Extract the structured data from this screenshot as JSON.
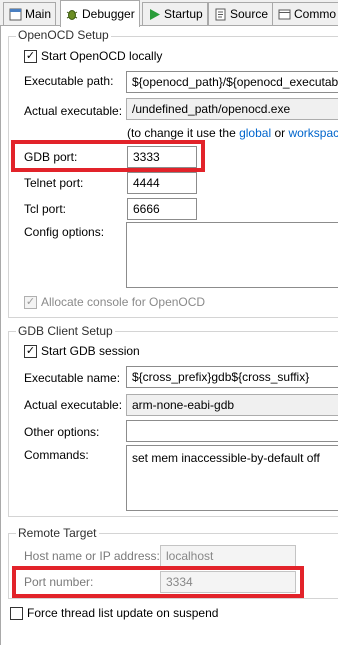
{
  "tabs": [
    {
      "label": "Main",
      "icon": "main-tab-icon"
    },
    {
      "label": "Debugger",
      "icon": "debugger-tab-icon"
    },
    {
      "label": "Startup",
      "icon": "startup-play-icon"
    },
    {
      "label": "Source",
      "icon": "source-tab-icon"
    },
    {
      "label": "Commo",
      "icon": "common-tab-icon"
    }
  ],
  "openocd": {
    "group_title": "OpenOCD Setup",
    "start_locally_label": "Start OpenOCD locally",
    "start_locally_checked": true,
    "exec_path_label": "Executable path:",
    "exec_path_value": "${openocd_path}/${openocd_executab",
    "actual_exec_label": "Actual executable:",
    "actual_exec_value": "/undefined_path/openocd.exe",
    "hint_prefix": "(to change it use the ",
    "hint_link1": "global",
    "hint_mid": " or ",
    "hint_link2": "workspac",
    "gdb_port_label": "GDB port:",
    "gdb_port_value": "3333",
    "telnet_port_label": "Telnet port:",
    "telnet_port_value": "4444",
    "tcl_port_label": "Tcl port:",
    "tcl_port_value": "6666",
    "config_options_label": "Config options:",
    "config_options_value": "",
    "allocate_console_label": "Allocate console for OpenOCD",
    "allocate_console_checked": true
  },
  "gdb_client": {
    "group_title": "GDB Client Setup",
    "start_session_label": "Start GDB session",
    "start_session_checked": true,
    "exec_name_label": "Executable name:",
    "exec_name_value": "${cross_prefix}gdb${cross_suffix}",
    "actual_exec_label": "Actual executable:",
    "actual_exec_value": "arm-none-eabi-gdb",
    "other_options_label": "Other options:",
    "other_options_value": "",
    "commands_label": "Commands:",
    "commands_value": "set mem inaccessible-by-default off"
  },
  "remote_target": {
    "group_title": "Remote Target",
    "host_label": "Host name or IP address:",
    "host_value": "localhost",
    "port_label": "Port number:",
    "port_value": "3334"
  },
  "force_thread": {
    "label": "Force thread list update on suspend",
    "checked": false
  },
  "colors": {
    "highlight": "#e2232a",
    "link": "#0065cc"
  }
}
